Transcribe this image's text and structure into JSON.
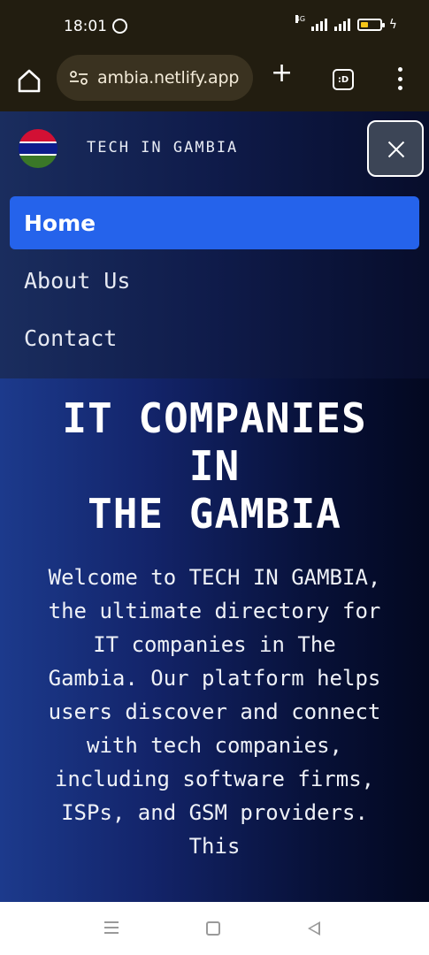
{
  "status_bar": {
    "time": "18:01",
    "network_label": "4G",
    "icons": [
      "whatsapp-icon",
      "signal-icon",
      "battery-icon",
      "charging-icon"
    ]
  },
  "browser": {
    "url": "ambia.netlify.app",
    "tab_label": ":D",
    "icons": [
      "home-icon",
      "tune-icon",
      "plus-icon",
      "tabs-icon",
      "more-vert-icon"
    ]
  },
  "site": {
    "brand": "TECH IN GAMBIA",
    "nav": [
      {
        "label": "Home",
        "active": true
      },
      {
        "label": "About Us",
        "active": false
      },
      {
        "label": "Contact",
        "active": false
      }
    ],
    "hero": {
      "title_line1": "IT COMPANIES",
      "title_line2": "IN",
      "title_line3": "THE GAMBIA",
      "description": "Welcome to TECH IN GAMBIA, the ultimate directory for IT companies in The Gambia. Our platform helps users discover and connect with tech companies, including software firms, ISPs, and GSM providers. This"
    }
  },
  "colors": {
    "accent": "#2563eb",
    "status_bg": "#221d10",
    "page_bg_left": "#1c3a8c",
    "page_bg_right": "#030820"
  }
}
